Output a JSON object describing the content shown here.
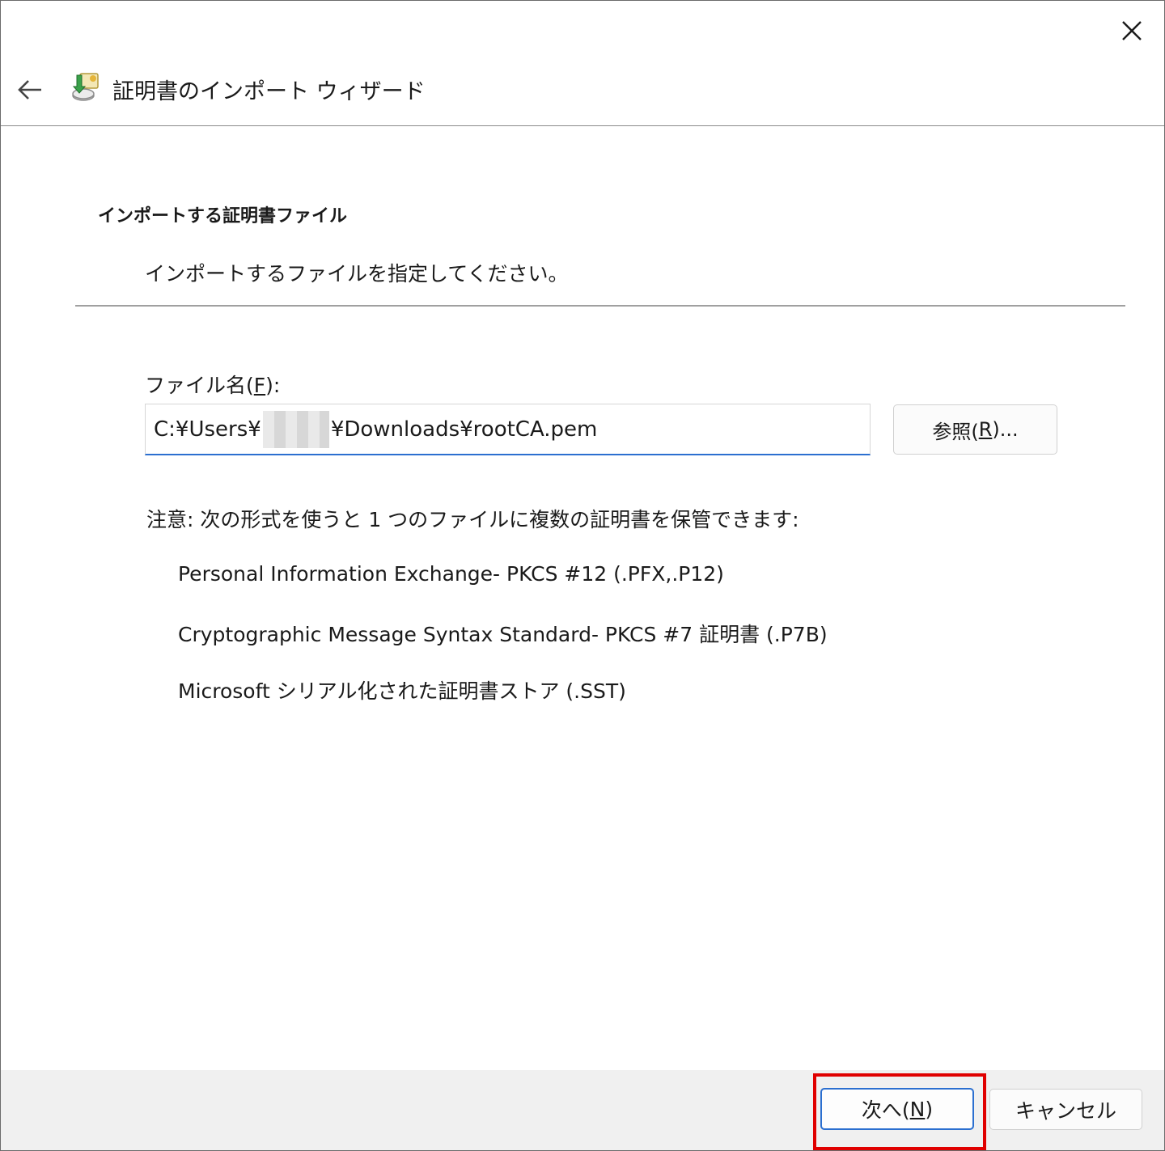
{
  "window": {
    "title": "証明書のインポート ウィザード",
    "close_icon": "close-icon",
    "back_icon": "back-arrow-icon",
    "wizard_icon": "certificate-import-icon"
  },
  "page": {
    "heading": "インポートする証明書ファイル",
    "description": "インポートするファイルを指定してください。"
  },
  "file_field": {
    "label_prefix": "ファイル名(",
    "label_accel": "F",
    "label_suffix": "):",
    "value_start": "C:¥Users¥",
    "value_end": "¥Downloads¥rootCA.pem"
  },
  "browse_button": {
    "prefix": "参照(",
    "accel": "R",
    "suffix": ")..."
  },
  "note": "注意: 次の形式を使うと 1 つのファイルに複数の証明書を保管できます:",
  "formats": [
    "Personal Information Exchange- PKCS #12 (.PFX,.P12)",
    "Cryptographic Message Syntax Standard- PKCS #7 証明書 (.P7B)",
    "Microsoft シリアル化された証明書ストア (.SST)"
  ],
  "footer": {
    "next_prefix": "次へ(",
    "next_accel": "N",
    "next_suffix": ")",
    "cancel_label": "キャンセル"
  },
  "colors": {
    "accent": "#2b6fd0",
    "highlight": "#e00000",
    "footer_bg": "#f0f0f0"
  }
}
